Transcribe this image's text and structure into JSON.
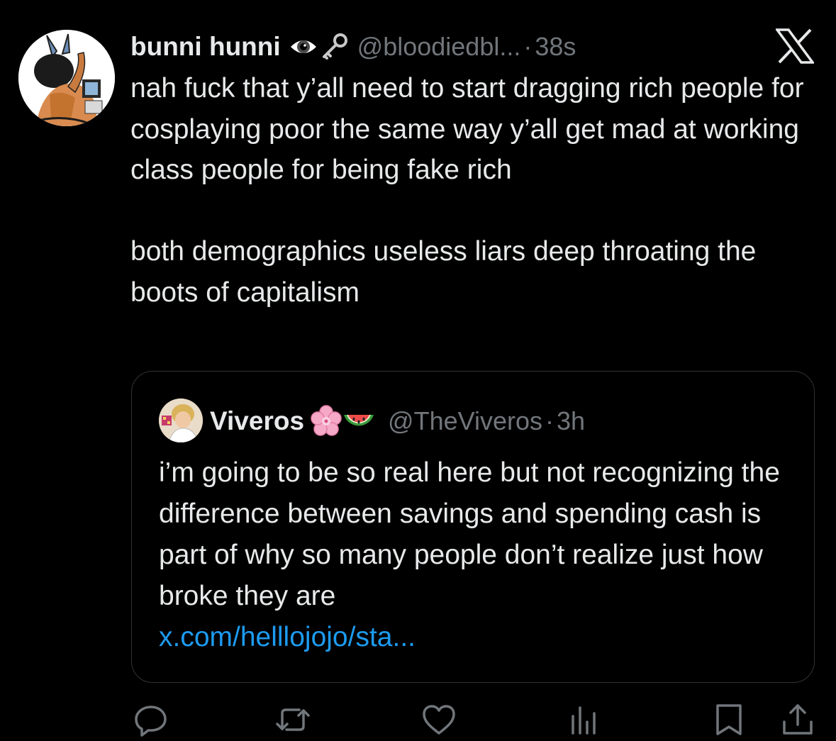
{
  "tweet": {
    "author": {
      "display_name": "bunni hunni",
      "handle": "@bloodiedbl...",
      "badges": [
        "eye-icon",
        "key-icon"
      ]
    },
    "separator": "·",
    "time": "38s",
    "text": "nah fuck that y’all need to start dragging rich people for cosplaying poor the same way y’all get mad at working class people for being fake rich\n\nboth demographics useless liars deep throating the boots of capitalism"
  },
  "quote": {
    "author": {
      "display_name": "Viveros",
      "emojis": [
        "cherry-blossom-emoji",
        "watermelon-emoji"
      ],
      "handle": "@TheViveros"
    },
    "separator": "·",
    "time": "3h",
    "text": "i’m going to be so real here but not recognizing the difference between savings and spending cash is part of why so many people don’t realize just how broke they are",
    "link": "x.com/helllojojo/sta..."
  },
  "actions": [
    "reply-icon",
    "repost-icon",
    "like-icon",
    "views-icon",
    "bookmark-icon",
    "share-icon"
  ],
  "colors": {
    "background": "#000000",
    "text": "#e7e9ea",
    "secondary": "#71767b",
    "link": "#1d9bf0",
    "border": "#2f3336"
  }
}
